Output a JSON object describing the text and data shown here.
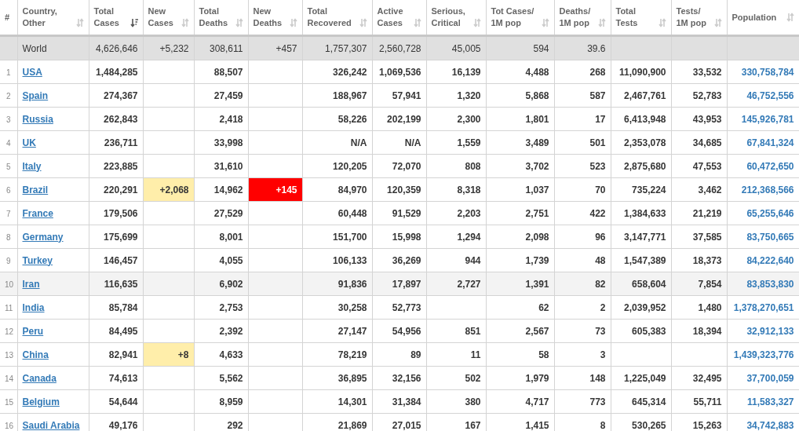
{
  "columns": [
    {
      "label": "#"
    },
    {
      "label": "Country,\nOther",
      "sorted": false
    },
    {
      "label": "Total\nCases",
      "sorted": true
    },
    {
      "label": "New\nCases",
      "sorted": false
    },
    {
      "label": "Total\nDeaths",
      "sorted": false
    },
    {
      "label": "New\nDeaths",
      "sorted": false
    },
    {
      "label": "Total\nRecovered",
      "sorted": false
    },
    {
      "label": "Active\nCases",
      "sorted": false
    },
    {
      "label": "Serious,\nCritical",
      "sorted": false
    },
    {
      "label": "Tot Cases/\n1M pop",
      "sorted": false
    },
    {
      "label": "Deaths/\n1M pop",
      "sorted": false
    },
    {
      "label": "Total\nTests",
      "sorted": false
    },
    {
      "label": "Tests/\n1M pop",
      "sorted": false
    },
    {
      "label": "Population",
      "sorted": false
    }
  ],
  "rows": [
    {
      "kind": "total",
      "country": "World",
      "selected": false,
      "cells": [
        "4,626,646",
        "+5,232",
        "308,611",
        "+457",
        "1,757,307",
        "2,560,728",
        "45,005",
        "594",
        "39.6",
        null,
        null,
        null
      ]
    },
    {
      "kind": "country",
      "rank": "1",
      "country": "USA",
      "selected": false,
      "cells": [
        "1,484,285",
        null,
        "88,507",
        null,
        "326,242",
        "1,069,536",
        "16,139",
        "4,488",
        "268",
        "11,090,900",
        "33,532",
        "330,758,784"
      ]
    },
    {
      "kind": "country",
      "rank": "2",
      "country": "Spain",
      "selected": false,
      "cells": [
        "274,367",
        null,
        "27,459",
        null,
        "188,967",
        "57,941",
        "1,320",
        "5,868",
        "587",
        "2,467,761",
        "52,783",
        "46,752,556"
      ]
    },
    {
      "kind": "country",
      "rank": "3",
      "country": "Russia",
      "selected": false,
      "cells": [
        "262,843",
        null,
        "2,418",
        null,
        "58,226",
        "202,199",
        "2,300",
        "1,801",
        "17",
        "6,413,948",
        "43,953",
        "145,926,781"
      ]
    },
    {
      "kind": "country",
      "rank": "4",
      "country": "UK",
      "selected": false,
      "cells": [
        "236,711",
        null,
        "33,998",
        null,
        "N/A",
        "N/A",
        "1,559",
        "3,489",
        "501",
        "2,353,078",
        "34,685",
        "67,841,324"
      ]
    },
    {
      "kind": "country",
      "rank": "5",
      "country": "Italy",
      "selected": false,
      "cells": [
        "223,885",
        null,
        "31,610",
        null,
        "120,205",
        "72,070",
        "808",
        "3,702",
        "523",
        "2,875,680",
        "47,553",
        "60,472,650"
      ]
    },
    {
      "kind": "country",
      "rank": "6",
      "country": "Brazil",
      "selected": false,
      "cells": [
        "220,291",
        {
          "text": "+2,068",
          "color": "#ffeeaa"
        },
        "14,962",
        {
          "text": "+145",
          "color": "#ff0000"
        },
        "84,970",
        "120,359",
        "8,318",
        "1,037",
        "70",
        "735,224",
        "3,462",
        "212,368,566"
      ]
    },
    {
      "kind": "country",
      "rank": "7",
      "country": "France",
      "selected": false,
      "cells": [
        "179,506",
        null,
        "27,529",
        null,
        "60,448",
        "91,529",
        "2,203",
        "2,751",
        "422",
        "1,384,633",
        "21,219",
        "65,255,646"
      ]
    },
    {
      "kind": "country",
      "rank": "8",
      "country": "Germany",
      "selected": false,
      "cells": [
        "175,699",
        null,
        "8,001",
        null,
        "151,700",
        "15,998",
        "1,294",
        "2,098",
        "96",
        "3,147,771",
        "37,585",
        "83,750,665"
      ]
    },
    {
      "kind": "country",
      "rank": "9",
      "country": "Turkey",
      "selected": false,
      "cells": [
        "146,457",
        null,
        "4,055",
        null,
        "106,133",
        "36,269",
        "944",
        "1,739",
        "48",
        "1,547,389",
        "18,373",
        "84,222,640"
      ]
    },
    {
      "kind": "country",
      "rank": "10",
      "country": "Iran",
      "selected": true,
      "cells": [
        "116,635",
        null,
        "6,902",
        null,
        "91,836",
        "17,897",
        "2,727",
        "1,391",
        "82",
        "658,604",
        "7,854",
        "83,853,830"
      ]
    },
    {
      "kind": "country",
      "rank": "11",
      "country": "India",
      "selected": false,
      "cells": [
        "85,784",
        null,
        "2,753",
        null,
        "30,258",
        "52,773",
        null,
        "62",
        "2",
        "2,039,952",
        "1,480",
        "1,378,270,651"
      ]
    },
    {
      "kind": "country",
      "rank": "12",
      "country": "Peru",
      "selected": false,
      "cells": [
        "84,495",
        null,
        "2,392",
        null,
        "27,147",
        "54,956",
        "851",
        "2,567",
        "73",
        "605,383",
        "18,394",
        "32,912,133"
      ]
    },
    {
      "kind": "country",
      "rank": "13",
      "country": "China",
      "selected": false,
      "cells": [
        "82,941",
        {
          "text": "+8",
          "color": "#ffeeaa"
        },
        "4,633",
        null,
        "78,219",
        "89",
        "11",
        "58",
        "3",
        null,
        null,
        "1,439,323,776"
      ]
    },
    {
      "kind": "country",
      "rank": "14",
      "country": "Canada",
      "selected": false,
      "cells": [
        "74,613",
        null,
        "5,562",
        null,
        "36,895",
        "32,156",
        "502",
        "1,979",
        "148",
        "1,225,049",
        "32,495",
        "37,700,059"
      ]
    },
    {
      "kind": "country",
      "rank": "15",
      "country": "Belgium",
      "selected": false,
      "cells": [
        "54,644",
        null,
        "8,959",
        null,
        "14,301",
        "31,384",
        "380",
        "4,717",
        "773",
        "645,314",
        "55,711",
        "11,583,327"
      ]
    },
    {
      "kind": "country",
      "rank": "16",
      "country": "Saudi Arabia",
      "selected": false,
      "cells": [
        "49,176",
        null,
        "292",
        null,
        "21,869",
        "27,015",
        "167",
        "1,415",
        "8",
        "530,265",
        "15,263",
        "34,742,883"
      ]
    }
  ]
}
